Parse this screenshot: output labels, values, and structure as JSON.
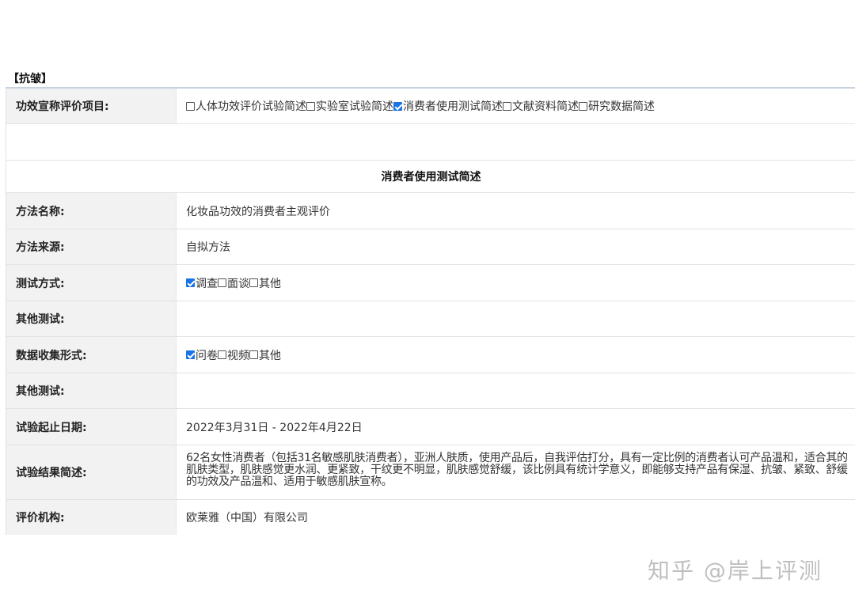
{
  "section_title": "【抗皱】",
  "claim_row": {
    "label": "功效宣称评价项目:",
    "options": [
      {
        "label": "人体功效评价试验简述",
        "checked": false
      },
      {
        "label": "实验室试验简述",
        "checked": false
      },
      {
        "label": "消费者使用测试简述",
        "checked": true
      },
      {
        "label": "文献资料简述",
        "checked": false
      },
      {
        "label": "研究数据简述",
        "checked": false
      }
    ]
  },
  "subheader": "消费者使用测试简述",
  "method_name": {
    "label": "方法名称:",
    "value": "化妆品功效的消费者主观评价"
  },
  "method_source": {
    "label": "方法来源:",
    "value": "自拟方法"
  },
  "test_mode": {
    "label": "测试方式:",
    "options": [
      {
        "label": "调查",
        "checked": true
      },
      {
        "label": "面谈",
        "checked": false
      },
      {
        "label": "其他",
        "checked": false
      }
    ]
  },
  "other_test_1": {
    "label": "其他测试:",
    "value": ""
  },
  "data_collection": {
    "label": "数据收集形式:",
    "options": [
      {
        "label": "问卷",
        "checked": true
      },
      {
        "label": "视频",
        "checked": false
      },
      {
        "label": "其他",
        "checked": false
      }
    ]
  },
  "other_test_2": {
    "label": "其他测试:",
    "value": ""
  },
  "test_period": {
    "label": "试验起止日期:",
    "value": "2022年3月31日 - 2022年4月22日"
  },
  "result_summary": {
    "label": "试验结果简述:",
    "value": "62名女性消费者（包括31名敏感肌肤消费者），亚洲人肤质，使用产品后，自我评估打分，具有一定比例的消费者认可产品温和，适合其的肌肤类型，肌肤感觉更水润、更紧致，干纹更不明显，肌肤感觉舒缓，该比例具有统计学意义，即能够支持产品有保湿、抗皱、紧致、舒缓的功效及产品温和、适用于敏感肌肤宣称。"
  },
  "institution": {
    "label": "评价机构:",
    "value": "欧莱雅（中国）有限公司"
  },
  "watermark": "知乎 @岸上评测"
}
